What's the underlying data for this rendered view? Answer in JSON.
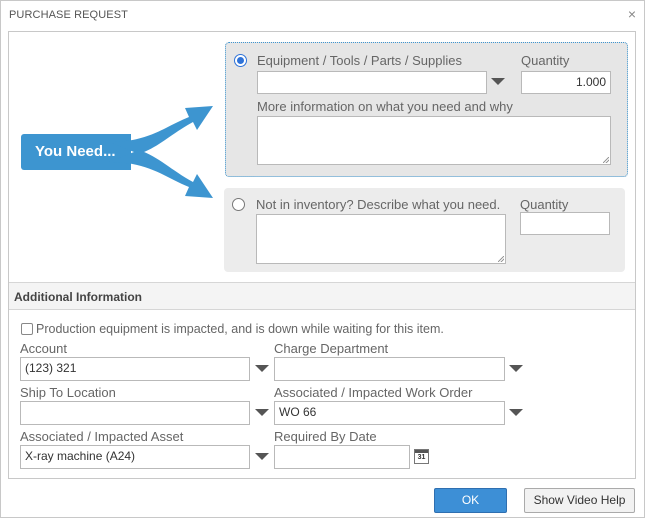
{
  "dialog": {
    "title": "PURCHASE REQUEST",
    "close_glyph": "×"
  },
  "callout": {
    "text": "You Need..."
  },
  "option_inventory": {
    "label": "Equipment / Tools / Parts / Supplies",
    "item_value": "",
    "quantity_label": "Quantity",
    "quantity_value": "1.000",
    "info_label": "More information on what you need and why",
    "info_value": ""
  },
  "option_non_inventory": {
    "label": "Not in inventory? Describe what you need.",
    "description_value": "",
    "quantity_label": "Quantity",
    "quantity_value": ""
  },
  "additional": {
    "header": "Additional Information",
    "production_label": "Production equipment is impacted, and is down while waiting for this item.",
    "account_label": "Account",
    "account_value": "(123) 321",
    "charge_label": "Charge Department",
    "charge_value": "",
    "ship_label": "Ship To Location",
    "ship_value": "",
    "work_order_label": "Associated / Impacted Work Order",
    "work_order_value": "WO 66",
    "asset_label": "Associated / Impacted Asset",
    "asset_value": "X-ray machine (A24)",
    "required_label": "Required By Date",
    "required_value": "",
    "calendar_text": "31"
  },
  "footer": {
    "ok_label": "OK",
    "help_label": "Show Video Help"
  },
  "colors": {
    "accent": "#3d95d0",
    "ok_button": "#3d8fd6",
    "panel": "#ececec"
  }
}
